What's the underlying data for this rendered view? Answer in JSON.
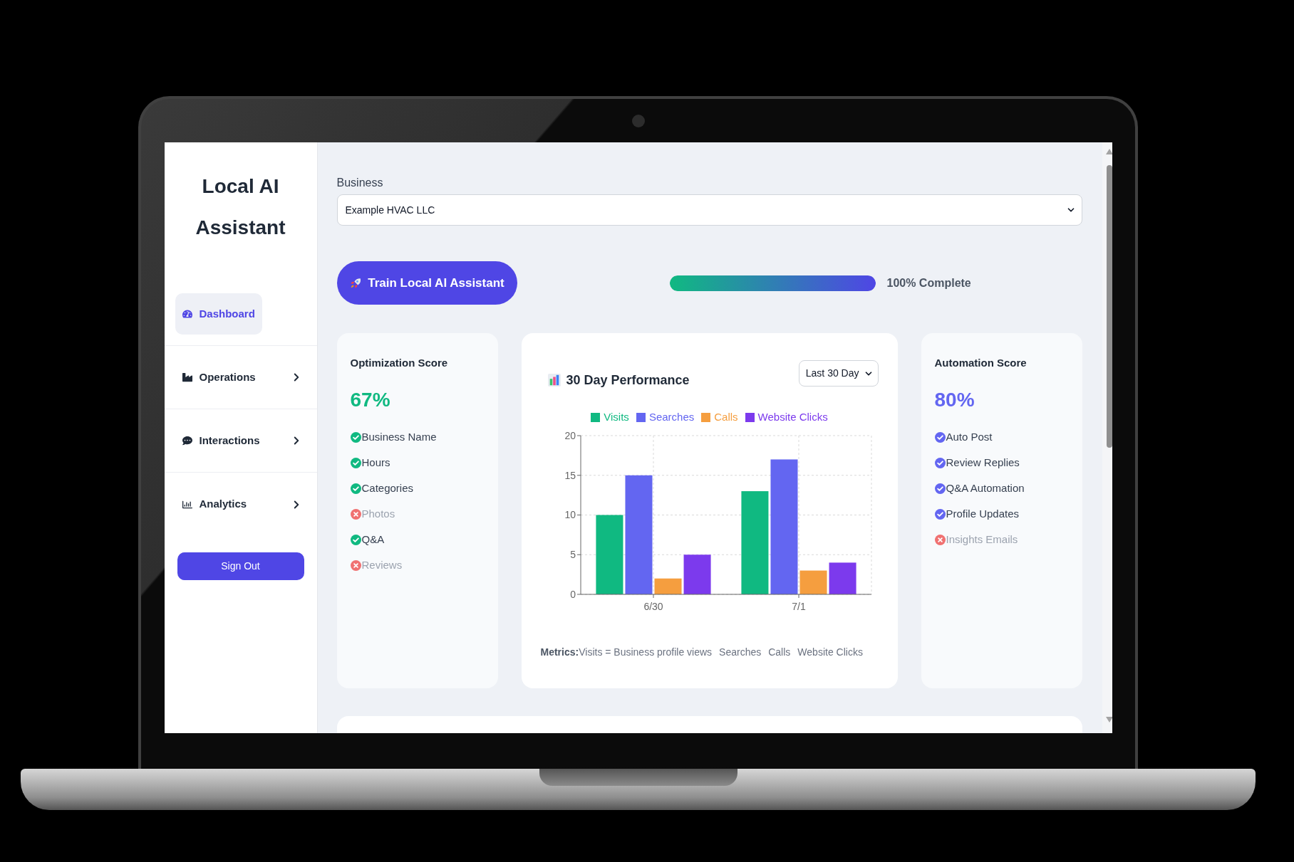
{
  "sidebar": {
    "title": "Local AI Assistant",
    "nav": [
      {
        "label": "Dashboard",
        "kind": "link",
        "selected": true
      },
      {
        "label": "Operations",
        "kind": "menu",
        "selected": false
      },
      {
        "label": "Interactions",
        "kind": "menu",
        "selected": false
      },
      {
        "label": "Analytics",
        "kind": "menu",
        "selected": false
      }
    ],
    "sign_out": "Sign Out"
  },
  "business": {
    "label": "Business",
    "value": "Example HVAC LLC"
  },
  "train_button": "Train Local AI Assistant",
  "progress": {
    "level": 1,
    "label": "100% Complete"
  },
  "cards": [
    {
      "kind": "score",
      "title": "Optimization Score",
      "value": "67%",
      "color": "#10b981",
      "items": [
        {
          "label": "Business Name",
          "done": true
        },
        {
          "label": "Hours",
          "done": true
        },
        {
          "label": "Categories",
          "done": true
        },
        {
          "label": "Photos",
          "done": false
        },
        {
          "label": "Q&A",
          "done": true
        },
        {
          "label": "Reviews",
          "done": false
        }
      ]
    },
    {
      "kind": "chart",
      "title": "30 Day Performance",
      "range": "Last 30 Day",
      "chart_data": {
        "type": "bar",
        "grid": true,
        "categories": [
          "6/30",
          "7/1"
        ],
        "series": [
          {
            "name": "Visits",
            "color": "#10b981",
            "values": [
              10,
              13
            ]
          },
          {
            "name": "Searches",
            "color": "#6366f1",
            "values": [
              15,
              17
            ]
          },
          {
            "name": "Calls",
            "color": "#f59e3f",
            "values": [
              2,
              3
            ]
          },
          {
            "name": "Website Clicks",
            "color": "#7c3aed",
            "values": [
              5,
              4
            ]
          }
        ],
        "ylim": [
          0,
          20
        ],
        "yticks": [
          0,
          5,
          10,
          15,
          20
        ]
      },
      "metrics": {
        "label": "Metrics:",
        "items": [
          "Visits = Business profile views",
          "Searches",
          "Calls",
          "Website Clicks"
        ]
      }
    },
    {
      "kind": "score",
      "title": "Automation Score",
      "value": "80%",
      "color": "#6366f1",
      "items": [
        {
          "label": "Auto Post",
          "done": true
        },
        {
          "label": "Review Replies",
          "done": true
        },
        {
          "label": "Q&A Automation",
          "done": true
        },
        {
          "label": "Profile Updates",
          "done": true
        },
        {
          "label": "Insights Emails",
          "done": false
        }
      ]
    }
  ]
}
